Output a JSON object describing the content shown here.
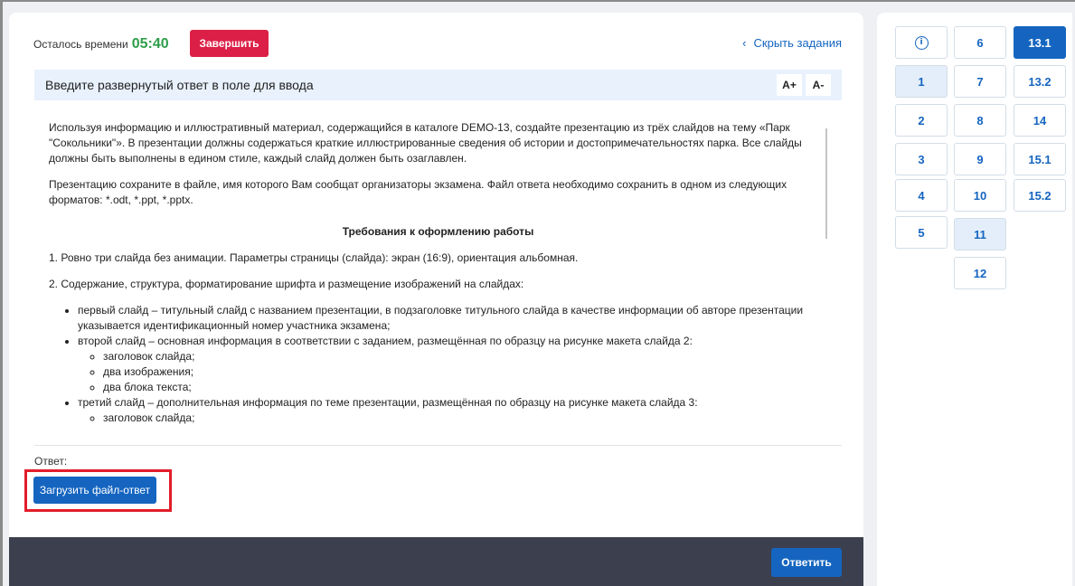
{
  "header": {
    "time_label": "Осталось времени",
    "time_value": "05:40",
    "finish_label": "Завершить",
    "hide_tasks_label": "Скрыть задания"
  },
  "instruction": {
    "text": "Введите развернутый ответ в поле для ввода",
    "font_increase": "A+",
    "font_decrease": "A-"
  },
  "task": {
    "p1": "Используя информацию и иллюстративный материал, содержащийся в каталоге DEMO-13, создайте презентацию из трёх слайдов на тему «Парк \"Сокольники\"». В презентации должны содержаться краткие иллюстрированные сведения об истории и достопримечательностях парка. Все слайды должны быть выполнены в едином стиле, каждый слайд должен быть озаглавлен.",
    "p2": "Презентацию сохраните в файле, имя которого Вам сообщат организаторы экзамена. Файл ответа необходимо сохранить в одном из следующих форматов: *.odt, *.ppt, *.pptx.",
    "req_heading": "Требования к оформлению работы",
    "req1": "1. Ровно три слайда без анимации. Параметры страницы (слайда): экран (16:9), ориентация альбомная.",
    "req2": "2. Содержание, структура, форматирование шрифта и размещение изображений на слайдах:",
    "slide1": "первый слайд – титульный слайд с названием презентации, в подзаголовке титульного слайда в качестве информации об авторе презентации указывается идентификационный номер участника экзамена;",
    "slide2": "второй слайд – основная информация в соответствии с заданием, размещённая по образцу на рисунке макета слайда 2:",
    "slide2_items": [
      "заголовок слайда;",
      "два изображения;",
      "два блока текста;"
    ],
    "slide3": "третий слайд – дополнительная информация по теме презентации, размещённая по образцу на рисунке макета слайда 3:",
    "slide3_partial": "заголовок слайда;"
  },
  "answer": {
    "label": "Ответ:",
    "upload_label": "Загрузить файл-ответ"
  },
  "footer": {
    "submit_label": "Ответить"
  },
  "nav": {
    "info_icon": "info-icon",
    "info_glyph": "i",
    "col1": [
      "1",
      "2",
      "3",
      "4",
      "5"
    ],
    "col2": [
      "6",
      "7",
      "8",
      "9",
      "10",
      "11",
      "12"
    ],
    "col3": [
      "13.1",
      "13.2",
      "14",
      "15.1",
      "15.2"
    ]
  },
  "colors": {
    "accent": "#1565c0",
    "danger": "#dc1f47",
    "timer": "#2e9e4a",
    "footer": "#3c3f4d",
    "highlight": "#e21d2a"
  }
}
